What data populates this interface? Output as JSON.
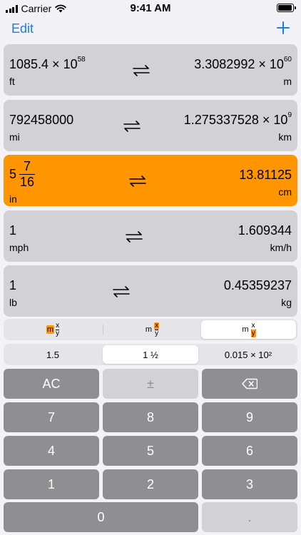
{
  "status_bar": {
    "carrier": "Carrier",
    "time": "9:41 AM"
  },
  "nav": {
    "edit_label": "Edit",
    "add_icon": "plus-icon"
  },
  "conversions": [
    {
      "left_value": "1085.4 × 10",
      "left_exp": "58",
      "left_unit": "ft",
      "right_value": "3.3082992 × 10",
      "right_exp": "60",
      "right_unit": "m"
    },
    {
      "left_value": "792458000",
      "left_exp": "",
      "left_unit": "mi",
      "right_value": "1.275337528 × 10",
      "right_exp": "9",
      "right_unit": "km"
    },
    {
      "left_whole": "5",
      "left_num": "7",
      "left_den": "16",
      "left_unit": "in",
      "right_value": "13.81125",
      "right_exp": "",
      "right_unit": "cm",
      "active": true,
      "color": "#ff9500"
    },
    {
      "left_value": "1",
      "left_exp": "",
      "left_unit": "mph",
      "right_value": "1.609344",
      "right_exp": "",
      "right_unit": "km/h"
    },
    {
      "left_value": "1",
      "left_exp": "",
      "left_unit": "lb",
      "right_value": "0.45359237",
      "right_exp": "",
      "right_unit": "kg"
    }
  ],
  "fraction_format": {
    "options": [
      {
        "m": "m",
        "x": "x",
        "y": "y",
        "highlight": "m"
      },
      {
        "m": "m",
        "x": "x",
        "y": "y",
        "highlight": "x"
      },
      {
        "m": "m",
        "x": "x",
        "y": "y",
        "highlight": "y"
      }
    ],
    "selected_index": 2
  },
  "number_format": {
    "options": [
      "1.5",
      "1 ½",
      "0.015 × 10²"
    ],
    "selected_index": 1
  },
  "keypad": {
    "ac": "AC",
    "plus_minus": "±",
    "delete_icon": "backspace-icon",
    "digits": [
      "7",
      "8",
      "9",
      "4",
      "5",
      "6",
      "1",
      "2",
      "3",
      "0"
    ],
    "decimal": "."
  },
  "colors": {
    "accent": "#1a7cf2",
    "active_card": "#ff9500",
    "key_dark": "#8e8e93",
    "key_light": "#d1d1d6"
  }
}
